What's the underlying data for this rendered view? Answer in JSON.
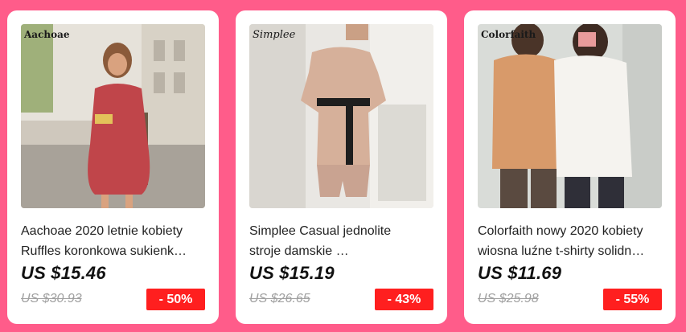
{
  "colors": {
    "page_background": "#ff5c8a",
    "badge": "#ff1f1f",
    "strikethrough_price": "#a0a0a0"
  },
  "products": [
    {
      "image_brand": "Aachoae",
      "title_line1": "Aachoae 2020 letnie kobiety",
      "title_line2": "Ruffles koronkowa sukienk…",
      "price": "US $15.46",
      "original_price": "US $30.93",
      "discount": "- 50%"
    },
    {
      "image_brand": "Simplee",
      "title_line1": "Simplee Casual jednolite",
      "title_line2": "stroje damskie …",
      "price": "US $15.19",
      "original_price": "US $26.65",
      "discount": "- 43%"
    },
    {
      "image_brand": "Colorfaith",
      "title_line1": "Colorfaith nowy 2020 kobiety",
      "title_line2": "wiosna luźne t-shirty solidn…",
      "price": "US $11.69",
      "original_price": "US $25.98",
      "discount": "- 55%"
    }
  ]
}
